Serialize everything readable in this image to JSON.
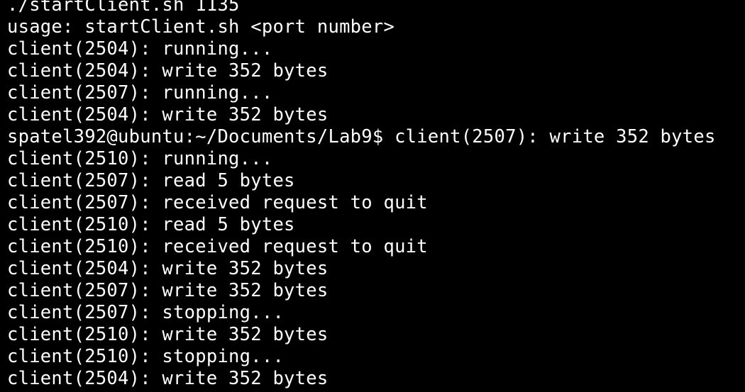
{
  "terminal": {
    "lines": [
      "./startClient.sh 1135",
      "usage: startClient.sh <port number>",
      "client(2504): running...",
      "client(2504): write 352 bytes",
      "client(2507): running...",
      "client(2504): write 352 bytes",
      "spatel392@ubuntu:~/Documents/Lab9$ client(2507): write 352 bytes",
      "client(2510): running...",
      "client(2507): read 5 bytes",
      "client(2507): received request to quit",
      "client(2510): read 5 bytes",
      "client(2510): received request to quit",
      "client(2504): write 352 bytes",
      "client(2507): write 352 bytes",
      "client(2507): stopping...",
      "client(2510): write 352 bytes",
      "client(2510): stopping...",
      "client(2504): write 352 bytes"
    ]
  }
}
